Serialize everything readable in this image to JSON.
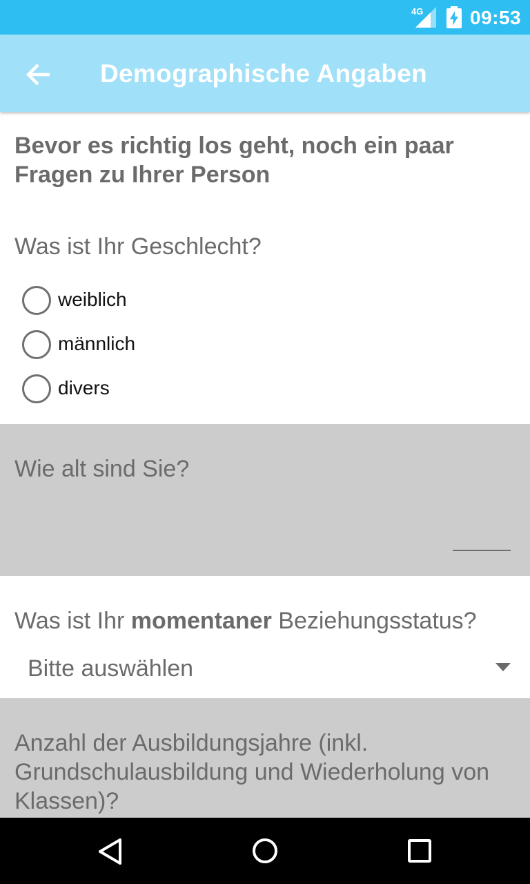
{
  "status_bar": {
    "network": "4G",
    "time": "09:53",
    "icons": [
      "signal-icon",
      "battery-charging-icon"
    ]
  },
  "app_bar": {
    "title": "Demographische Angaben",
    "back_icon": "arrow-left-icon"
  },
  "intro": "Bevor es richtig los geht, noch ein paar Fragen zu Ihrer Person",
  "gender": {
    "question": "Was ist Ihr Geschlecht?",
    "options": [
      "weiblich",
      "männlich",
      "divers"
    ],
    "selected": null
  },
  "age": {
    "question": "Wie alt sind Sie?",
    "value": ""
  },
  "relationship": {
    "question_prefix": "Was ist Ihr",
    "question_bold": "momentaner",
    "question_suffix": "Beziehungsstatus?",
    "selected": "Bitte auswählen"
  },
  "education": {
    "question": "Anzahl der Ausbildungsjahre (inkl. Grundschulausbildung und Wiederholung von Klassen)?"
  },
  "nav_bar": {
    "icons": [
      "back-triangle-icon",
      "home-circle-icon",
      "recents-square-icon"
    ]
  },
  "colors": {
    "status_bar": "#2ebef2",
    "app_bar": "#a0e0f8",
    "section_gray": "#cccccc"
  }
}
